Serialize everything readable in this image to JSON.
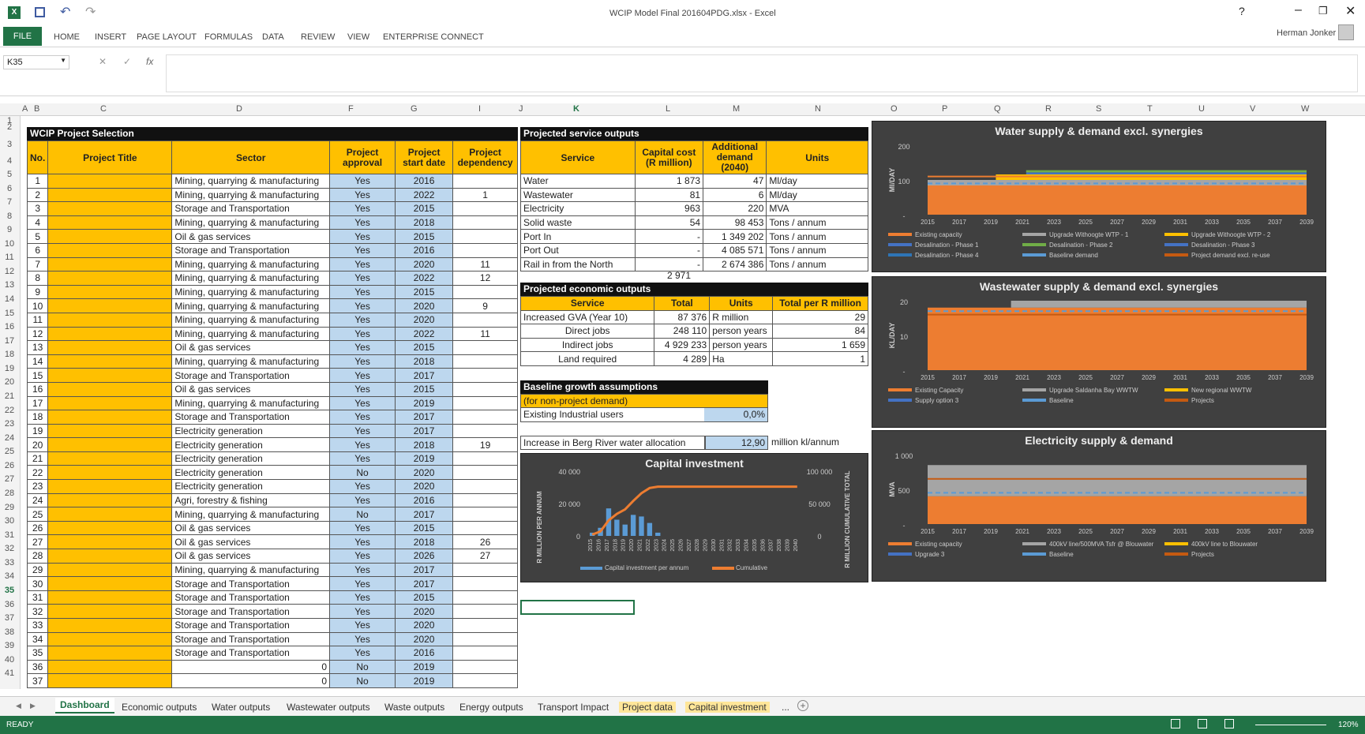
{
  "window": {
    "title": "WCIP Model Final 201604PDG.xlsx - Excel",
    "user": "Herman Jonker"
  },
  "ribbon": {
    "file": "FILE",
    "tabs": [
      "HOME",
      "INSERT",
      "PAGE LAYOUT",
      "FORMULAS",
      "DATA",
      "REVIEW",
      "VIEW",
      "ENTERPRISE CONNECT"
    ]
  },
  "formula_bar": {
    "name_box": "K35",
    "fx": "fx",
    "value": ""
  },
  "columns": [
    "A",
    "B",
    "C",
    "D",
    "F",
    "G",
    "I",
    "J",
    "K",
    "L",
    "M",
    "N",
    "O",
    "P",
    "Q",
    "R",
    "S",
    "T",
    "U",
    "V",
    "W"
  ],
  "rows": [
    "1",
    "2",
    "3",
    "4",
    "5",
    "6",
    "7",
    "8",
    "9",
    "10",
    "11",
    "12",
    "13",
    "14",
    "15",
    "16",
    "17",
    "18",
    "19",
    "20",
    "21",
    "22",
    "23",
    "24",
    "25",
    "26",
    "27",
    "28",
    "29",
    "30",
    "31",
    "32",
    "33",
    "34",
    "35",
    "36",
    "37",
    "38",
    "39",
    "40",
    "41"
  ],
  "project_table": {
    "title": "WCIP Project Selection",
    "headers": [
      "No.",
      "Project Title",
      "Sector",
      "Project approval",
      "Project start date",
      "Project dependency"
    ],
    "rows": [
      [
        "1",
        "",
        "Mining, quarrying & manufacturing",
        "Yes",
        "2016",
        ""
      ],
      [
        "2",
        "",
        "Mining, quarrying & manufacturing",
        "Yes",
        "2022",
        "1"
      ],
      [
        "3",
        "",
        "Storage and Transportation",
        "Yes",
        "2015",
        ""
      ],
      [
        "4",
        "",
        "Mining, quarrying & manufacturing",
        "Yes",
        "2018",
        ""
      ],
      [
        "5",
        "",
        "Oil & gas services",
        "Yes",
        "2015",
        ""
      ],
      [
        "6",
        "",
        "Storage and Transportation",
        "Yes",
        "2016",
        ""
      ],
      [
        "7",
        "",
        "Mining, quarrying & manufacturing",
        "Yes",
        "2020",
        "11"
      ],
      [
        "8",
        "",
        "Mining, quarrying & manufacturing",
        "Yes",
        "2022",
        "12"
      ],
      [
        "9",
        "",
        "Mining, quarrying & manufacturing",
        "Yes",
        "2015",
        ""
      ],
      [
        "10",
        "",
        "Mining, quarrying & manufacturing",
        "Yes",
        "2020",
        "9"
      ],
      [
        "11",
        "",
        "Mining, quarrying & manufacturing",
        "Yes",
        "2020",
        ""
      ],
      [
        "12",
        "",
        "Mining, quarrying & manufacturing",
        "Yes",
        "2022",
        "11"
      ],
      [
        "13",
        "",
        "Oil & gas services",
        "Yes",
        "2015",
        ""
      ],
      [
        "14",
        "",
        "Mining, quarrying & manufacturing",
        "Yes",
        "2018",
        ""
      ],
      [
        "15",
        "",
        "Storage and Transportation",
        "Yes",
        "2017",
        ""
      ],
      [
        "16",
        "",
        "Oil & gas services",
        "Yes",
        "2015",
        ""
      ],
      [
        "17",
        "",
        "Mining, quarrying & manufacturing",
        "Yes",
        "2019",
        ""
      ],
      [
        "18",
        "",
        "Storage and Transportation",
        "Yes",
        "2017",
        ""
      ],
      [
        "19",
        "",
        "Electricity generation",
        "Yes",
        "2017",
        ""
      ],
      [
        "20",
        "",
        "Electricity generation",
        "Yes",
        "2018",
        "19"
      ],
      [
        "21",
        "",
        "Electricity generation",
        "Yes",
        "2019",
        ""
      ],
      [
        "22",
        "",
        "Electricity generation",
        "No",
        "2020",
        ""
      ],
      [
        "23",
        "",
        "Electricity generation",
        "Yes",
        "2020",
        ""
      ],
      [
        "24",
        "",
        "Agri, forestry & fishing",
        "Yes",
        "2016",
        ""
      ],
      [
        "25",
        "",
        "Mining, quarrying & manufacturing",
        "No",
        "2017",
        ""
      ],
      [
        "26",
        "",
        "Oil & gas services",
        "Yes",
        "2015",
        ""
      ],
      [
        "27",
        "",
        "Oil & gas services",
        "Yes",
        "2018",
        "26"
      ],
      [
        "28",
        "",
        "Oil & gas services",
        "Yes",
        "2026",
        "27"
      ],
      [
        "29",
        "",
        "Mining, quarrying & manufacturing",
        "Yes",
        "2017",
        ""
      ],
      [
        "30",
        "",
        "Storage and Transportation",
        "Yes",
        "2017",
        ""
      ],
      [
        "31",
        "",
        "Storage and Transportation",
        "Yes",
        "2015",
        ""
      ],
      [
        "32",
        "",
        "Storage and Transportation",
        "Yes",
        "2020",
        ""
      ],
      [
        "33",
        "",
        "Storage and Transportation",
        "Yes",
        "2020",
        ""
      ],
      [
        "34",
        "",
        "Storage and Transportation",
        "Yes",
        "2020",
        ""
      ],
      [
        "35",
        "",
        "Storage and Transportation",
        "Yes",
        "2016",
        ""
      ],
      [
        "36",
        "",
        "0",
        "No",
        "2019",
        ""
      ],
      [
        "37",
        "",
        "0",
        "No",
        "2019",
        ""
      ]
    ]
  },
  "service_outputs": {
    "title": "Projected service outputs",
    "headers": [
      "Service",
      "Capital cost (R million)",
      "Additional demand (2040)",
      "Units"
    ],
    "rows": [
      [
        "Water",
        "1 873",
        "47",
        "Ml/day"
      ],
      [
        "Wastewater",
        "81",
        "6",
        "Ml/day"
      ],
      [
        "Electricity",
        "963",
        "220",
        "MVA"
      ],
      [
        "Solid waste",
        "54",
        "98 453",
        "Tons / annum"
      ],
      [
        "Port In",
        "-",
        "1 349 202",
        "Tons / annum"
      ],
      [
        "Port Out",
        "-",
        "4 085 571",
        "Tons / annum"
      ],
      [
        "Rail in from the North",
        "-",
        "2 674 386",
        "Tons / annum"
      ]
    ],
    "total": "2 971"
  },
  "economic_outputs": {
    "title": "Projected economic outputs",
    "headers": [
      "Service",
      "Total",
      "Units",
      "Total per R million"
    ],
    "rows": [
      [
        "Increased GVA (Year 10)",
        "87 376",
        "R million",
        "29"
      ],
      [
        "Direct jobs",
        "248 110",
        "person years",
        "84"
      ],
      [
        "Indirect jobs",
        "4 929 233",
        "person years",
        "1 659"
      ],
      [
        "Land required",
        "4 289",
        "Ha",
        "1"
      ]
    ]
  },
  "baseline": {
    "title": "Baseline growth assumptions",
    "subtitle": "(for non-project demand)",
    "label": "Existing Industrial users",
    "value": "0,0%"
  },
  "berg": {
    "label": "Increase in Berg River water allocation",
    "value": "12,90",
    "units": "million kl/annum"
  },
  "capital_chart": {
    "title": "Capital investment",
    "y_left_label": "R MILLION PER ANNUM",
    "y_right_label": "R MILLION CUMULATIVE TOTAL",
    "left_ticks": [
      "40 000",
      "20 000",
      "0"
    ],
    "right_ticks": [
      "100 000",
      "50 000",
      "0"
    ],
    "legend": [
      "Capital investment per annum",
      "Cumulative"
    ]
  },
  "chart_data": [
    {
      "type": "area",
      "title": "Water supply & demand excl. synergies",
      "ylabel": "Ml/DAY",
      "yticks": [
        "200",
        "100",
        "-"
      ],
      "x": [
        "2015",
        "2017",
        "2019",
        "2021",
        "2023",
        "2025",
        "2027",
        "2029",
        "2031",
        "2033",
        "2035",
        "2037",
        "2039"
      ],
      "legend": [
        "Existing capacity",
        "Upgrade Withoogte WTP - 1",
        "Upgrade Withoogte WTP - 2",
        "Desalination - Phase 1",
        "Desalination - Phase 2",
        "Desalination - Phase 3",
        "Desalination - Phase 4",
        "Baseline demand",
        "Project demand excl. re-use"
      ],
      "colors": {
        "existing": "#ed7d31",
        "upgrade1": "#a5a5a5",
        "upgrade2": "#ffc000",
        "desal1": "#4472c4",
        "desal2": "#70ad47",
        "baseline": "#5b9bd5"
      }
    },
    {
      "type": "area",
      "title": "Wastewater supply & demand excl. synergies",
      "ylabel": "KL/DAY",
      "yticks": [
        "20",
        "10",
        "-"
      ],
      "x": [
        "2015",
        "2017",
        "2019",
        "2021",
        "2023",
        "2025",
        "2027",
        "2029",
        "2031",
        "2033",
        "2035",
        "2037",
        "2039"
      ],
      "legend": [
        "Existing Capacity",
        "Upgrade Saldanha Bay WWTW",
        "New regional WWTW",
        "Supply option 3",
        "Baseline",
        "Projects"
      ]
    },
    {
      "type": "area",
      "title": "Electricity supply & demand",
      "ylabel": "MVA",
      "yticks": [
        "1 000",
        "500",
        "-"
      ],
      "x": [
        "2015",
        "2017",
        "2019",
        "2021",
        "2023",
        "2025",
        "2027",
        "2029",
        "2031",
        "2033",
        "2035",
        "2037",
        "2039"
      ],
      "legend": [
        "Existing capacity",
        "400kV line/500MVA Tsfr @ Blouwater",
        "400kV line to Blouwater",
        "Upgrade 3",
        "Baseline",
        "Projects"
      ]
    },
    {
      "type": "bar",
      "title": "Capital investment",
      "x": [
        "2015",
        "2016",
        "2017",
        "2018",
        "2019",
        "2020",
        "2021",
        "2022",
        "2023",
        "2024",
        "2025",
        "2026",
        "2027",
        "2028",
        "2029",
        "2030",
        "2031",
        "2032",
        "2033",
        "2034",
        "2035",
        "2036",
        "2037",
        "2038",
        "2039",
        "2040"
      ],
      "series": [
        {
          "name": "Capital investment per annum",
          "values": [
            2000,
            5000,
            17000,
            10000,
            7000,
            13000,
            12000,
            8000,
            2000,
            0,
            0,
            0,
            0,
            0,
            0,
            0,
            0,
            0,
            0,
            0,
            0,
            0,
            0,
            0,
            0,
            0
          ]
        },
        {
          "name": "Cumulative",
          "values": [
            2000,
            7000,
            24000,
            34000,
            41000,
            54000,
            66000,
            74000,
            76000,
            76000,
            76000,
            76000,
            76000,
            76000,
            76000,
            76000,
            76000,
            76000,
            76000,
            76000,
            76000,
            76000,
            76000,
            76000,
            76000,
            76000
          ]
        }
      ],
      "ylim": [
        0,
        40000
      ],
      "y2lim": [
        0,
        100000
      ]
    }
  ],
  "sheet_tabs": [
    "Dashboard",
    "Economic outputs",
    "Water outputs",
    "Wastewater outputs",
    "Waste outputs",
    "Energy outputs",
    "Transport Impact",
    "Project data",
    "Capital investment",
    "..."
  ],
  "status": {
    "ready": "READY",
    "zoom": "120%"
  }
}
